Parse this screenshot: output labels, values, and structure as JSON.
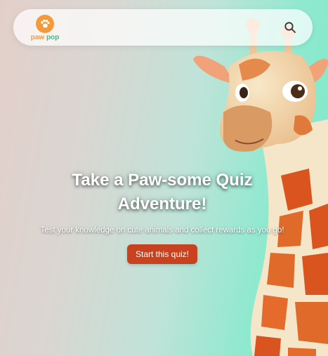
{
  "brand": {
    "word1": "paw",
    "word2": "pop",
    "icon": "paw-icon",
    "color1": "#f39a3c",
    "color2": "#34c28f"
  },
  "navbar": {
    "search_icon": "search-icon"
  },
  "hero": {
    "title": "Take a Paw-some Quiz Adventure!",
    "subtitle": "Test your knowledge on cute animals and collect rewards as you go!",
    "cta_label": "Start this quiz!",
    "cta_color": "#c8421f",
    "image": "cartoon-giraffe"
  }
}
